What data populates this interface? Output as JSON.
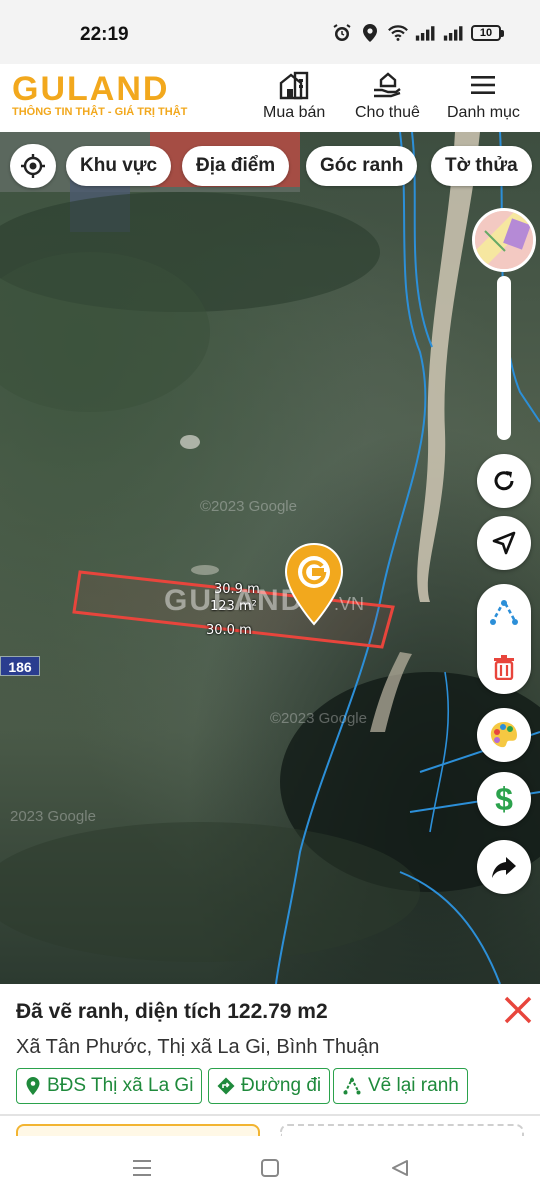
{
  "status": {
    "time": "22:19",
    "battery": "10"
  },
  "header": {
    "logo_text": "GULAND",
    "tagline": "THÔNG TIN THẬT - GIÁ TRỊ THẬT",
    "nav": [
      {
        "label": "Mua bán",
        "icon": "building-icon"
      },
      {
        "label": "Cho thuê",
        "icon": "hand-house-icon"
      },
      {
        "label": "Danh mục",
        "icon": "menu-icon"
      }
    ]
  },
  "filters": {
    "locate_icon": "target-icon",
    "chips": [
      "Khu vực",
      "Địa điểm",
      "Góc ranh",
      "Tờ thửa"
    ]
  },
  "map": {
    "plot": {
      "width_top": "30.9 m",
      "area": "123 m²",
      "width_bottom": "30.0 m"
    },
    "watermark": "GULAND",
    "watermark_suffix": ".VN",
    "google_credit": "©2023 Google",
    "google_credit_2": "©2023 Google",
    "google_credit_3": "2023 Google",
    "road_label": "186",
    "tools": [
      "refresh-icon",
      "navigate-icon",
      "draw-boundary-icon",
      "delete-icon",
      "palette-icon",
      "price-icon",
      "share-icon"
    ]
  },
  "info": {
    "title": "Đã vẽ ranh, diện tích 122.79 m2",
    "address": "Xã Tân Phước, Thị xã La Gi, Bình Thuận",
    "actions": [
      {
        "label": "BĐS Thị xã La Gi",
        "icon": "location-pin-icon"
      },
      {
        "label": "Đường đi",
        "icon": "directions-icon"
      },
      {
        "label": "Vẽ lại ranh",
        "icon": "redraw-icon"
      }
    ]
  },
  "colors": {
    "brand": "#f2a81d",
    "action_green": "#2ba24c",
    "boundary_red": "#e8453c",
    "parcel_blue": "#2c8fd8"
  }
}
